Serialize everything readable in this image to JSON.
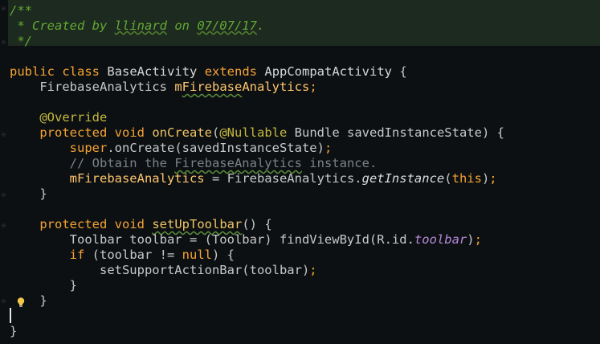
{
  "code": {
    "l1": "/**",
    "l2_pre": " * Created by ",
    "l2_user": "llinard",
    "l2_mid": " on ",
    "l2_date": "07/07/17",
    "l2_end": ".",
    "l3": " */",
    "l5_kw1": "public",
    "l5_kw2": "class",
    "l5_cls": "BaseActivity",
    "l5_kw3": "extends",
    "l5_super": "AppCompatActivity",
    "l5_brace": " {",
    "l6_type": "FirebaseAnalytics",
    "l6_pre": "m",
    "l6_sq": "Firebase",
    "l6_post": "Analytics",
    "l8": "@Override",
    "l9_kw1": "protected",
    "l9_kw2": "void",
    "l9_fn": "onCreate",
    "l9_ann": "@Nullable",
    "l9_rest": " Bundle savedInstanceState) {",
    "l10_kw": "super",
    "l10_rest": ".onCreate(savedInstanceState)",
    "l11_pre": "// Obtain the ",
    "l11_sq": "FirebaseAnalytics",
    "l11_post": " instance.",
    "l12_field": "mFirebaseAnalytics",
    "l12_mid": " = FirebaseAnalytics.",
    "l12_method": "getInstance",
    "l12_kw": "this",
    "l13": "}",
    "l15_kw1": "protected",
    "l15_kw2": "void",
    "l15_fn": "setUpToolbar",
    "l15_rest": "() {",
    "l16_pre": "Toolbar toolbar = (Toolbar) findViewById(R.id.",
    "l16_field": "toolbar",
    "l16_end": ")",
    "l17_kw": "if",
    "l17_mid": " (toolbar != ",
    "l17_null": "null",
    "l17_end": ") {",
    "l18_pre": "setSupportActionBar(toolbar)",
    "l19": "}",
    "l20": "}",
    "l22": "}"
  },
  "colors": {
    "background": "#0c1013",
    "keyword": "#f6a333",
    "comment_doc": "#63a833",
    "line_comment": "#7c8288",
    "annotation": "#c5b83c",
    "static_field": "#b68ad8"
  },
  "icons": {
    "intention": "lightbulb-icon"
  }
}
